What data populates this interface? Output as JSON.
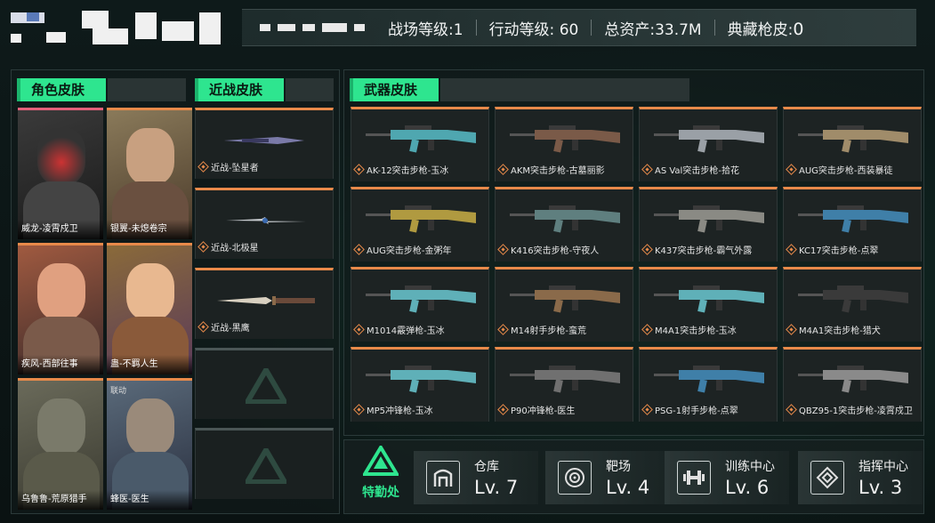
{
  "header": {
    "stats": [
      {
        "label": "战场等级:",
        "value": "1"
      },
      {
        "label": "行动等级:",
        "value": "60"
      },
      {
        "label": "总资产:",
        "value": "33.7M"
      },
      {
        "label": "典藏枪皮:",
        "value": "0"
      }
    ]
  },
  "sections": {
    "characters": "角色皮肤",
    "melee": "近战皮肤",
    "weapons": "武器皮肤"
  },
  "characters": [
    {
      "label": "威龙-凌霄戍卫",
      "badge": ""
    },
    {
      "label": "银翼-未熄卷宗",
      "badge": ""
    },
    {
      "label": "疾风-西部往事",
      "badge": ""
    },
    {
      "label": "蛊-不羁人生",
      "badge": ""
    },
    {
      "label": "乌鲁鲁-荒原猎手",
      "badge": ""
    },
    {
      "label": "蜂医-医生",
      "badge": "联动"
    }
  ],
  "melee": [
    {
      "label": "近战-坠星者"
    },
    {
      "label": "近战-北极星"
    },
    {
      "label": "近战-黑鹰"
    }
  ],
  "weapons": [
    {
      "label": "AK-12突击步枪-玉冰",
      "color": "#4fa7b0"
    },
    {
      "label": "AKM突击步枪-古墓丽影",
      "color": "#7a5a48"
    },
    {
      "label": "AS Val突击步枪-拾花",
      "color": "#9aa0a6"
    },
    {
      "label": "AUG突击步枪-西装暴徒",
      "color": "#a08c6a"
    },
    {
      "label": "AUG突击步枪-金粥年",
      "color": "#b09a40"
    },
    {
      "label": "K416突击步枪-守夜人",
      "color": "#5f7f7f"
    },
    {
      "label": "K437突击步枪-霸气外露",
      "color": "#8a8a84"
    },
    {
      "label": "KC17突击步枪-点翠",
      "color": "#3f7fa8"
    },
    {
      "label": "M1014霰弹枪-玉冰",
      "color": "#5fb0b8"
    },
    {
      "label": "M14射手步枪-蛮荒",
      "color": "#8a6a4a"
    },
    {
      "label": "M4A1突击步枪-玉冰",
      "color": "#5fb0b8"
    },
    {
      "label": "M4A1突击步枪-猎犬",
      "color": "#3a3a3a"
    },
    {
      "label": "MP5冲锋枪-玉冰",
      "color": "#5fb0b8"
    },
    {
      "label": "P90冲锋枪-医生",
      "color": "#707070"
    },
    {
      "label": "PSG-1射手步枪-点翠",
      "color": "#3f7fa8"
    },
    {
      "label": "QBZ95-1突击步枪-凌霄戍卫",
      "color": "#8a8a8a"
    }
  ],
  "bottom": {
    "agent_office": "特勤处",
    "facilities": [
      {
        "name": "仓库",
        "level": "Lv. 7",
        "icon": "warehouse-icon"
      },
      {
        "name": "靶场",
        "level": "Lv. 4",
        "icon": "target-icon"
      },
      {
        "name": "训练中心",
        "level": "Lv. 6",
        "icon": "dumbbell-icon"
      },
      {
        "name": "指挥中心",
        "level": "Lv. 3",
        "icon": "command-icon"
      }
    ]
  }
}
